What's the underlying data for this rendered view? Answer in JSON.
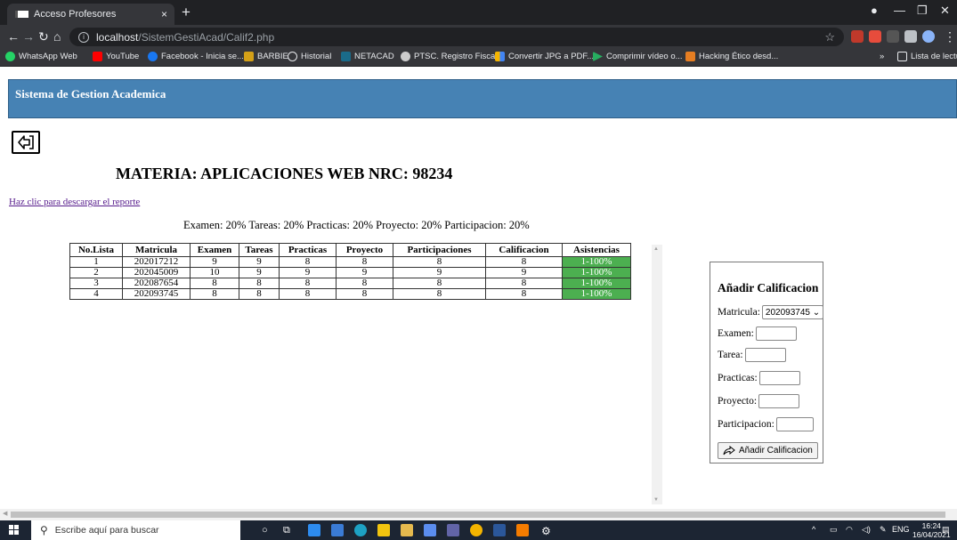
{
  "browser": {
    "tab_title": "Acceso Profesores",
    "tab_close": "×",
    "new_tab": "+",
    "url_host": "localhost",
    "url_path": "/SistemGestiAcad/Calif2.php",
    "bookmarks": [
      "WhatsApp Web",
      "YouTube",
      "Facebook - Inicia se...",
      "BARBIE",
      "Historial",
      "NETACAD",
      "PTSC. Registro Fisca...",
      "Convertir JPG a PDF...",
      "Comprimir vídeo o...",
      "Hacking Ético desd..."
    ],
    "reading_list": "Lista de lectura"
  },
  "page": {
    "header_title": "Sistema de Gestion Academica",
    "materia_heading": "MATERIA: APLICACIONES WEB NRC: 98234",
    "report_link": "Haz clic para descargar el reporte",
    "weights_line": "Examen: 20% Tareas: 20% Practicas: 20% Proyecto: 20% Participacion: 20%"
  },
  "table": {
    "headers": [
      "No.Lista",
      "Matricula",
      "Examen",
      "Tareas",
      "Practicas",
      "Proyecto",
      "Participaciones",
      "Calificacion",
      "Asistencias"
    ],
    "rows": [
      [
        "1",
        "202017212",
        "9",
        "9",
        "8",
        "8",
        "8",
        "8",
        "1-100%"
      ],
      [
        "2",
        "202045009",
        "10",
        "9",
        "9",
        "9",
        "9",
        "9",
        "1-100%"
      ],
      [
        "3",
        "202087654",
        "8",
        "8",
        "8",
        "8",
        "8",
        "8",
        "1-100%"
      ],
      [
        "4",
        "202093745",
        "8",
        "8",
        "8",
        "8",
        "8",
        "8",
        "1-100%"
      ]
    ],
    "asistencias_color": "#4caf50"
  },
  "form": {
    "title": "Añadir Calificacion",
    "matricula_label": "Matricula:",
    "matricula_selected": "202093745",
    "examen_label": "Examen:",
    "tarea_label": "Tarea:",
    "practicas_label": "Practicas:",
    "proyecto_label": "Proyecto:",
    "participacion_label": "Participacion:",
    "submit_label": "Añadir Calificacion"
  },
  "taskbar": {
    "search_placeholder": "Escribe aquí para buscar",
    "lang": "ENG",
    "time": "16:24",
    "date": "16/04/2021"
  },
  "colors": {
    "header_bg": "#4682b4",
    "link": "#551a8b"
  }
}
